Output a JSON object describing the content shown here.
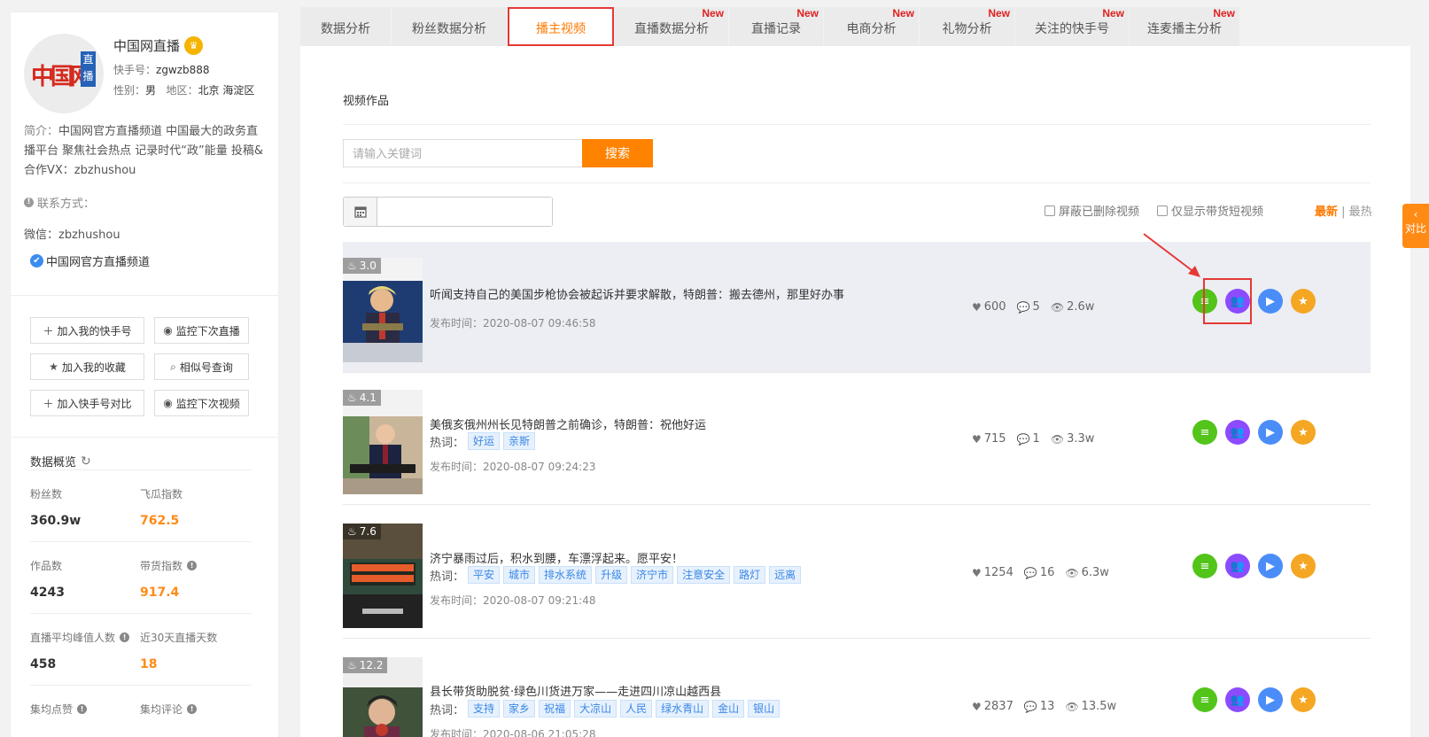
{
  "profile": {
    "name": "中国网直播",
    "avatar_text": "中国网",
    "avatar_badge": "直播",
    "kuaishou_id_label": "快手号：",
    "kuaishou_id": "zgwzb888",
    "gender_label": "性别：",
    "gender": "男",
    "region_label": "地区：",
    "region": "北京 海淀区",
    "bio_label": "简介：",
    "bio": "中国网官方直播频道 中国最大的政务直播平台 聚焦社会热点 记录时代“政”能量 投稿&合作VX：zbzhushou",
    "contact_label": "联系方式：",
    "wechat": "微信：zbzhushou",
    "verified": "中国网官方直播频道"
  },
  "actions": {
    "add_kuaishou": "加入我的快手号",
    "monitor_live": "监控下次直播",
    "add_favorite": "加入我的收藏",
    "similar": "相似号查询",
    "add_compare": "加入快手号对比",
    "monitor_video": "监控下次视频"
  },
  "overview": {
    "title": "数据概览",
    "fans_label": "粉丝数",
    "fans": "360.9w",
    "feigua_label": "飞瓜指数",
    "feigua": "762.5",
    "works_label": "作品数",
    "works": "4243",
    "sales_label": "带货指数",
    "sales": "917.4",
    "live_peak_label": "直播平均峰值人数",
    "live_peak": "458",
    "live_days_label": "近30天直播天数",
    "live_days": "18",
    "avg_like_label": "集均点赞",
    "avg_comment_label": "集均评论"
  },
  "tabs": [
    {
      "label": "数据分析",
      "new": ""
    },
    {
      "label": "粉丝数据分析",
      "new": ""
    },
    {
      "label": "播主视频",
      "new": ""
    },
    {
      "label": "直播数据分析",
      "new": "New"
    },
    {
      "label": "直播记录",
      "new": "New"
    },
    {
      "label": "电商分析",
      "new": "New"
    },
    {
      "label": "礼物分析",
      "new": "New"
    },
    {
      "label": "关注的快手号",
      "new": "New"
    },
    {
      "label": "连麦播主分析",
      "new": "New"
    }
  ],
  "main": {
    "section_title": "视频作品",
    "search_placeholder": "请输入关键词",
    "search_button": "搜索",
    "filter_deleted": "屏蔽已删除视频",
    "filter_goods": "仅显示带货短视频",
    "sort_latest": "最新",
    "sort_sep": " | ",
    "sort_hot": "最热",
    "hot_words_label": "热词：",
    "publish_label": "发布时间："
  },
  "videos": [
    {
      "heat": "3.0",
      "title": "听闻支持自己的美国步枪协会被起诉并要求解散，特朗普：搬去德州，那里好办事",
      "tags": [],
      "time": "2020-08-07 09:46:58",
      "likes": "600",
      "comments": "5",
      "views": "2.6w"
    },
    {
      "heat": "4.1",
      "title": "美俄亥俄州州长见特朗普之前确诊，特朗普：祝他好运",
      "tags": [
        "好运",
        "亲斯"
      ],
      "time": "2020-08-07 09:24:23",
      "likes": "715",
      "comments": "1",
      "views": "3.3w"
    },
    {
      "heat": "7.6",
      "title": "济宁暴雨过后，积水到腰，车漂浮起来。愿平安！",
      "tags": [
        "平安",
        "城市",
        "排水系统",
        "升级",
        "济宁市",
        "注意安全",
        "路灯",
        "远离"
      ],
      "time": "2020-08-07 09:21:48",
      "likes": "1254",
      "comments": "16",
      "views": "6.3w"
    },
    {
      "heat": "12.2",
      "title": "县长带货助脱贫·绿色川货进万家——走进四川凉山越西县",
      "tags": [
        "支持",
        "家乡",
        "祝福",
        "大凉山",
        "人民",
        "绿水青山",
        "金山",
        "银山"
      ],
      "time": "2020-08-06 21:05:28",
      "likes": "2837",
      "comments": "13",
      "views": "13.5w"
    }
  ],
  "side_tab": "对比",
  "colors": {
    "accent": "#ff8200",
    "highlight": "#e53935"
  }
}
